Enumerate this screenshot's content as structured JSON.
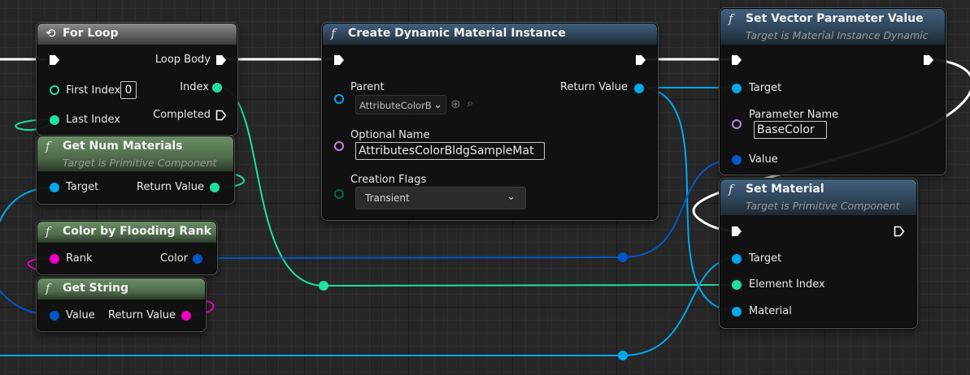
{
  "colors": {
    "exec": "#ffffff",
    "object": "#00a8f0",
    "integer": "#1fe0a0",
    "linear_color": "#0058c8",
    "string": "#f000c8",
    "name": "#c080e0",
    "byte": "#006858"
  },
  "for_loop": {
    "title": "For Loop",
    "icon": "loop-icon",
    "pins": {
      "loop_body": "Loop Body",
      "first_index": "First Index",
      "first_index_value": "0",
      "index": "Index",
      "last_index": "Last Index",
      "completed": "Completed"
    }
  },
  "get_num_materials": {
    "title": "Get Num Materials",
    "subtitle": "Target is Primitive Component",
    "pins": {
      "target": "Target",
      "return_value": "Return Value"
    }
  },
  "color_by_flooding_rank": {
    "title": "Color by Flooding Rank",
    "pins": {
      "rank": "Rank",
      "color": "Color"
    }
  },
  "get_string": {
    "title": "Get String",
    "pins": {
      "value": "Value",
      "return_value": "Return Value"
    }
  },
  "create_dynamic_material_instance": {
    "title": "Create Dynamic Material Instance",
    "pins": {
      "parent": "Parent",
      "parent_value": "AttributeColorB",
      "return_value": "Return Value",
      "optional_name": "Optional Name",
      "optional_name_value": "AttributesColorBldgSampleMat",
      "creation_flags": "Creation Flags",
      "creation_flags_value": "Transient"
    }
  },
  "set_vector_parameter_value": {
    "title": "Set Vector Parameter Value",
    "subtitle": "Target is Material Instance Dynamic",
    "pins": {
      "target": "Target",
      "parameter_name": "Parameter Name",
      "parameter_name_value": "BaseColor",
      "value": "Value"
    }
  },
  "set_material": {
    "title": "Set Material",
    "subtitle": "Target is Primitive Component",
    "pins": {
      "target": "Target",
      "element_index": "Element Index",
      "material": "Material"
    }
  },
  "function_glyph": "f"
}
